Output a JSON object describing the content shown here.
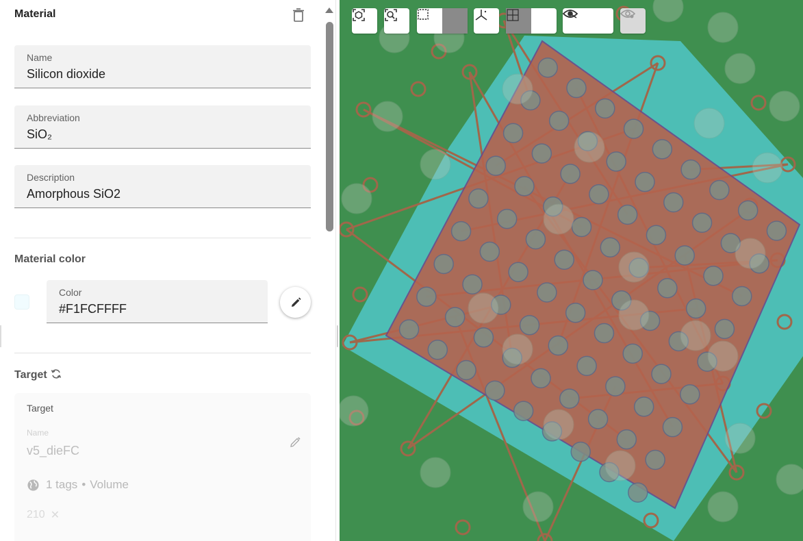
{
  "material": {
    "section_title": "Material",
    "name_label": "Name",
    "name_value": "Silicon dioxide",
    "abbr_label": "Abbreviation",
    "abbr_value": "SiO₂",
    "desc_label": "Description",
    "desc_value": "Amorphous SiO2"
  },
  "material_color": {
    "section_title": "Material color",
    "color_label": "Color",
    "color_value": "#F1FCFFFF",
    "swatch_hex": "#F1FCFF"
  },
  "target": {
    "section_title": "Target",
    "card_label": "Target",
    "name_label": "Name",
    "name_value": "v5_dieFC",
    "tags_text": "1 tags",
    "separator": "•",
    "kind_text": "Volume",
    "chip_value": "210"
  },
  "toolbar": {
    "buttons": [
      "focus-selection-icon",
      "zoom-fit-icon",
      "box-select-icon",
      "lasso-select-icon",
      "axes-icon",
      "single-view-icon",
      "quad-view-icon",
      "hide-icon",
      "show-icon",
      "show-all-disabled-icon"
    ]
  },
  "colors": {
    "board_green": "#3f8f4f",
    "package_cyan": "#4fc3c0",
    "die_red": "#b5634e",
    "trace_brown": "#a0674a",
    "bump": "#7f8f86"
  }
}
